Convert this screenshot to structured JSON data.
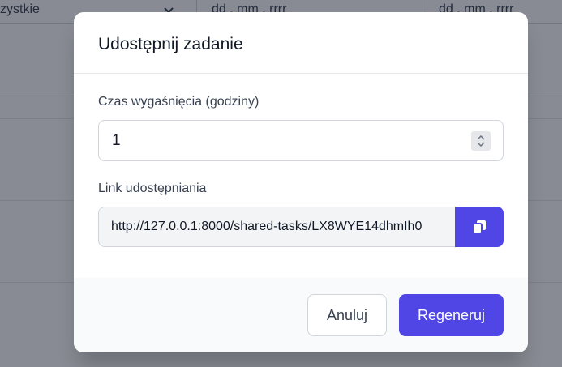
{
  "background": {
    "filter_select_value": "zystkie",
    "date_from_placeholder": "dd . mm . rrrr",
    "date_to_placeholder": "dd . mm . rrrr"
  },
  "modal": {
    "title": "Udostępnij zadanie",
    "expiry_label": "Czas wygaśnięcia (godziny)",
    "expiry_value": "1",
    "link_label": "Link udostępniania",
    "link_value": "http://127.0.0.1:8000/shared-tasks/LX8WYE14dhmIh0",
    "copy_icon": "copy-icon",
    "cancel_label": "Anuluj",
    "regenerate_label": "Regeneruj"
  },
  "colors": {
    "primary": "#4f46e5",
    "overlay": "rgba(17,24,39,0.5)"
  }
}
